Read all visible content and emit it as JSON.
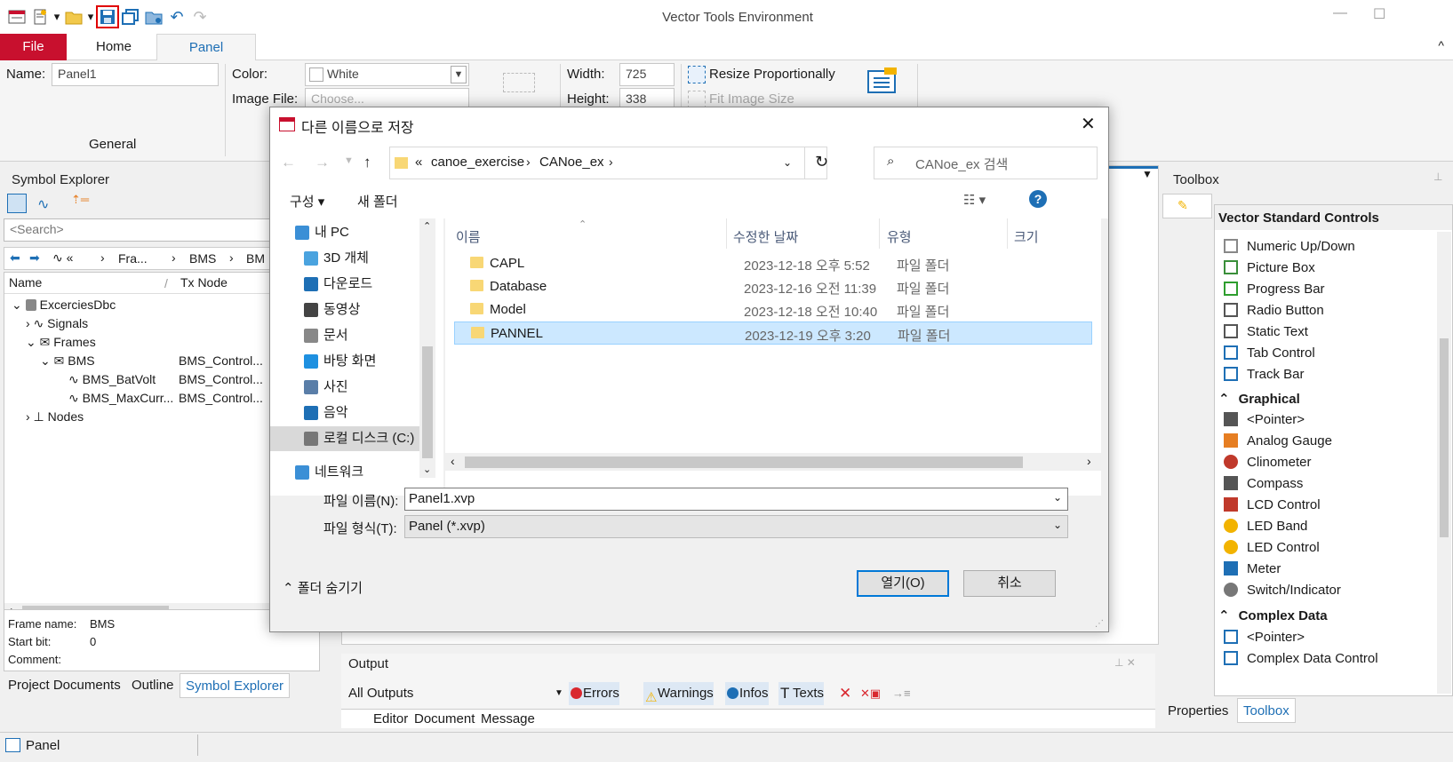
{
  "app": {
    "title": "Vector Tools Environment"
  },
  "ribbon": {
    "tabs": [
      "File",
      "Home",
      "Panel"
    ],
    "name_label": "Name:",
    "name_value": "Panel1",
    "color_label": "Color:",
    "color_value": "White",
    "image_file_label": "Image File:",
    "image_file_placeholder": "Choose...",
    "width_label": "Width:",
    "width_value": "725",
    "height_label": "Height:",
    "height_value": "338",
    "resize_label": "Resize Proportionally",
    "fit_label": "Fit Image Size",
    "group_general": "General"
  },
  "symbol_explorer": {
    "title": "Symbol Explorer",
    "search_placeholder": "<Search>",
    "breadcrumb": [
      "Fra...",
      "BMS",
      "BM"
    ],
    "col_name": "Name",
    "col_txnode": "Tx Node",
    "tree": [
      {
        "label": "ExcerciesDbc",
        "tx": ""
      },
      {
        "label": "Signals",
        "tx": ""
      },
      {
        "label": "Frames",
        "tx": ""
      },
      {
        "label": "BMS",
        "tx": "BMS_Control..."
      },
      {
        "label": "BMS_BatVolt",
        "tx": "BMS_Control..."
      },
      {
        "label": "BMS_MaxCurr...",
        "tx": "BMS_Control..."
      },
      {
        "label": "Nodes",
        "tx": ""
      }
    ],
    "details": {
      "frame_label": "Frame name:",
      "frame_value": "BMS",
      "start_label": "Start bit:",
      "start_value": "0",
      "comment_label": "Comment:"
    },
    "bottom_tabs": [
      "Project Documents",
      "Outline",
      "Symbol Explorer"
    ]
  },
  "status": {
    "doc_tab": "Panel"
  },
  "output": {
    "title": "Output",
    "filter": "All Outputs",
    "buttons": [
      "Errors",
      "Warnings",
      "Infos",
      "Texts"
    ],
    "columns": [
      "Editor",
      "Document",
      "Message"
    ]
  },
  "toolbox": {
    "title": "Toolbox",
    "group1": "Vector Standard Controls",
    "std_items": [
      "Numeric Up/Down",
      "Picture Box",
      "Progress Bar",
      "Radio Button",
      "Static Text",
      "Tab Control",
      "Track Bar"
    ],
    "group2": "Graphical",
    "graph_items": [
      "<Pointer>",
      "Analog Gauge",
      "Clinometer",
      "Compass",
      "LCD Control",
      "LED Band",
      "LED Control",
      "Meter",
      "Switch/Indicator"
    ],
    "group3": "Complex Data",
    "complex_items": [
      "<Pointer>",
      "Complex Data Control"
    ],
    "bottom_tabs": [
      "Properties",
      "Toolbox"
    ]
  },
  "dialog": {
    "title": "다른 이름으로 저장",
    "path": [
      "canoe_exercise",
      "CANoe_ex"
    ],
    "path_prefix": "«",
    "search_placeholder": "CANoe_ex 검색",
    "organize": "구성",
    "new_folder": "새 폴더",
    "nav": [
      "내 PC",
      "3D 개체",
      "다운로드",
      "동영상",
      "문서",
      "바탕 화면",
      "사진",
      "음악",
      "로컬 디스크 (C:)",
      "네트워크"
    ],
    "columns": [
      "이름",
      "수정한 날짜",
      "유형",
      "크기"
    ],
    "files": [
      {
        "name": "CAPL",
        "date": "2023-12-18 오후 5:52",
        "type": "파일 폴더"
      },
      {
        "name": "Database",
        "date": "2023-12-16 오전 11:39",
        "type": "파일 폴더"
      },
      {
        "name": "Model",
        "date": "2023-12-18 오전 10:40",
        "type": "파일 폴더"
      },
      {
        "name": "PANNEL",
        "date": "2023-12-19 오후 3:20",
        "type": "파일 폴더"
      }
    ],
    "filename_label": "파일 이름(N):",
    "filename_value": "Panel1.xvp",
    "filetype_label": "파일 형식(T):",
    "filetype_value": "Panel (*.xvp)",
    "hide_folders": "폴더 숨기기",
    "open_button": "열기(O)",
    "cancel_button": "취소"
  }
}
